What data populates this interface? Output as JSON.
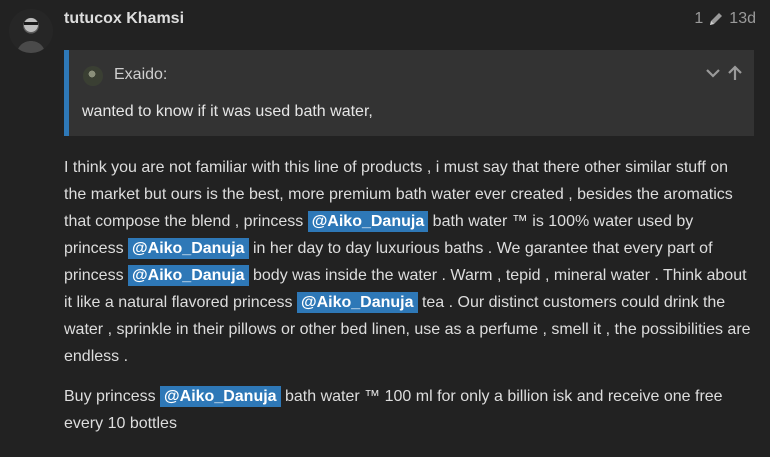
{
  "post": {
    "username": "tutucox Khamsi",
    "edit_count": "1",
    "age": "13d",
    "quote": {
      "author": "Exaido:",
      "text": "wanted to know if it was used bath water,"
    },
    "paragraph1": {
      "t1": "I think you are not familiar with this line of products , i must say that there other similar stuff on the market but ours is the best, more premium bath water ever created , besides the aromatics that compose the blend , princess ",
      "t2": " bath water ™ is 100% water used by princess ",
      "t3": " in her day to day luxurious baths . We garantee that every part of princess ",
      "t4": " body was inside the water . Warm , tepid , mineral water . Think about it like a natural flavored princess ",
      "t5": " tea . Our distinct customers could drink the water , sprinkle in their pillows or other bed linen, use as a perfume , smell it , the possibilities are endless ."
    },
    "paragraph2": {
      "t1": "Buy princess ",
      "t2": " bath water ™ 100 ml for only a billion isk and receive one free every 10 bottles"
    },
    "mention": "@Aiko_Danuja"
  },
  "icons": {
    "edit": "pencil-icon",
    "expand": "chevron-down-icon",
    "jump": "arrow-up-icon"
  },
  "colors": {
    "background": "#222222",
    "quote_background": "#333333",
    "accent": "#2e78b7"
  }
}
